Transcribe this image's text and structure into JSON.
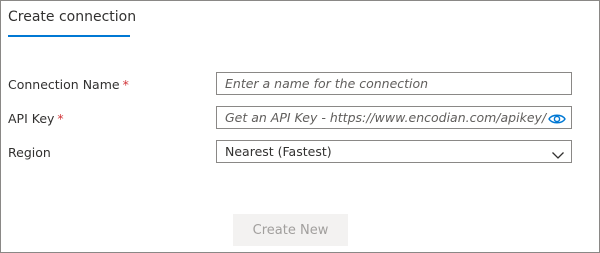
{
  "dialog": {
    "tab_title": "Create connection"
  },
  "fields": {
    "connection_name": {
      "label": "Connection Name",
      "required_marker": "*",
      "placeholder": "Enter a name for the connection"
    },
    "api_key": {
      "label": "API Key",
      "required_marker": "*",
      "placeholder": "Get an API Key - https://www.encodian.com/apikey/",
      "icon": "eye-icon"
    },
    "region": {
      "label": "Region",
      "value": "Nearest (Fastest)",
      "icon": "chevron-down-icon"
    }
  },
  "actions": {
    "create_new_label": "Create New"
  },
  "colors": {
    "accent": "#0078d4",
    "required": "#d13438",
    "button_disabled_bg": "#f3f2f1",
    "button_disabled_text": "#a19f9d"
  }
}
